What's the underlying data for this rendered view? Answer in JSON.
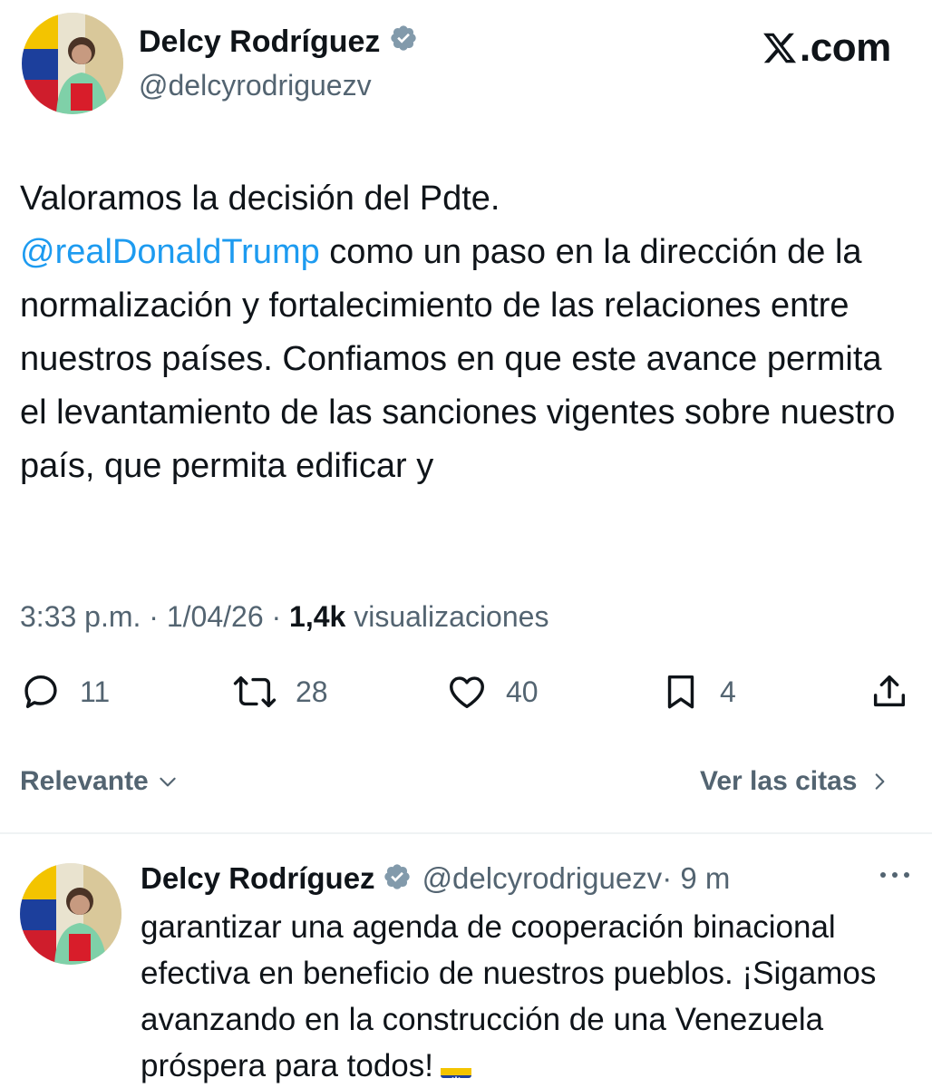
{
  "brand": {
    "logo_text": ".com"
  },
  "tweet": {
    "author_name": "Delcy Rodríguez",
    "author_handle": "@delcyrodriguezv",
    "text_intro": "Valoramos la decisión del Pdte.",
    "mention": "@realDonaldTrump",
    "text_body": " como un paso en la dirección de la normalización y fortalecimiento de las relaciones entre nuestros países. Confiamos en que este avance permita el levantamiento de las sanciones vigentes sobre nuestro país, que permita edificar y",
    "time": "3:33 p.m. · 1/04/26 · ",
    "views_count": "1,4k",
    "views_label": " visualizaciones"
  },
  "actions": {
    "replies": "11",
    "retweets": "28",
    "likes": "40",
    "bookmarks": "4"
  },
  "replies_section": {
    "sort_label": "Relevante",
    "quotes_label": "Ver las citas"
  },
  "reply": {
    "author_name": "Delcy Rodríguez",
    "author_handle": "@delcyrodriguezv",
    "age": " · 9 m",
    "text": "garantizar una agenda de cooperación binacional efectiva en beneficio de nuestros pueblos. ¡Sigamos avanzando en la construcción de una Venezuela próspera para todos!",
    "flag_icon": "venezuela-flag-icon"
  },
  "colors": {
    "text": "#0f1419",
    "secondary": "#536471",
    "link": "#1d9bf0",
    "verified": "#829aab",
    "divider": "#eff3f4"
  }
}
